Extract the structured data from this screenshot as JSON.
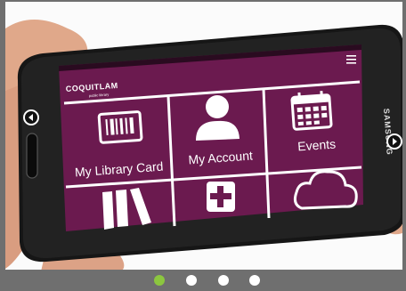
{
  "carousel": {
    "prev_icon": "chevron-left-icon",
    "next_icon": "chevron-right-icon",
    "active_index": 0,
    "slide_count": 4,
    "active_dot_color": "#8cc63f",
    "inactive_dot_color": "#ffffff",
    "bar_color": "#6f6f6f"
  },
  "phone": {
    "vendor": "SAMSUNG",
    "app": {
      "brand": "COQUITLAM",
      "brand_sub": "public library",
      "menu_icon": "hamburger-icon",
      "accent_color": "#6b1a4f",
      "tiles": [
        {
          "label": "My Library Card",
          "icon": "barcode-icon"
        },
        {
          "label": "My Account",
          "icon": "person-icon"
        },
        {
          "label": "Events",
          "icon": "calendar-icon"
        },
        {
          "label": "",
          "icon": "books-icon"
        },
        {
          "label": "",
          "icon": "plus-icon"
        },
        {
          "label": "",
          "icon": "cloud-icon"
        }
      ]
    }
  }
}
